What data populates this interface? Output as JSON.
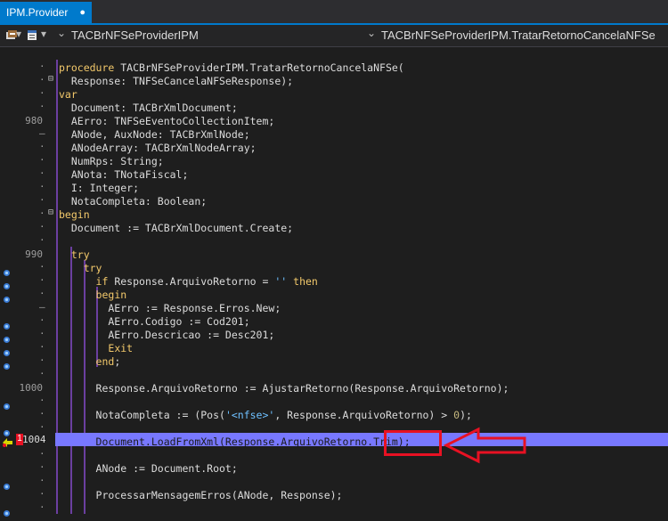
{
  "tab": {
    "title": "IPM.Provider",
    "close": "●"
  },
  "nav": {
    "left": "TACBrNFSeProviderIPM",
    "right": "TACBrNFSeProviderIPM.TratarRetornoCancelaNFSe",
    "chevron": "⌄"
  },
  "current_line": "1004",
  "current_marker": "1",
  "code_lines": [
    {
      "ln": "",
      "text": "procedure TACBrNFSeProviderIPM.TratarRetornoCancelaNFSe("
    },
    {
      "ln": "",
      "text": "  Response: TNFSeCancelaNFSeResponse);"
    },
    {
      "ln": "",
      "text": "var"
    },
    {
      "ln": "",
      "text": "  Document: TACBrXmlDocument;"
    },
    {
      "ln": "980",
      "text": "  AErro: TNFSeEventoCollectionItem;"
    },
    {
      "ln": "",
      "text": "  ANode, AuxNode: TACBrXmlNode;"
    },
    {
      "ln": "",
      "text": "  ANodeArray: TACBrXmlNodeArray;"
    },
    {
      "ln": "",
      "text": "  NumRps: String;"
    },
    {
      "ln": "",
      "text": "  ANota: TNotaFiscal;"
    },
    {
      "ln": "",
      "text": "  I: Integer;"
    },
    {
      "ln": "",
      "text": "  NotaCompleta: Boolean;"
    },
    {
      "ln": "",
      "text": "begin"
    },
    {
      "ln": "",
      "text": "  Document := TACBrXmlDocument.Create;"
    },
    {
      "ln": "",
      "text": ""
    },
    {
      "ln": "990",
      "text": "  try"
    },
    {
      "ln": "",
      "text": "    try"
    },
    {
      "ln": "",
      "text": "      if Response.ArquivoRetorno = '' then"
    },
    {
      "ln": "",
      "text": "      begin"
    },
    {
      "ln": "",
      "text": "        AErro := Response.Erros.New;"
    },
    {
      "ln": "",
      "text": "        AErro.Codigo := Cod201;"
    },
    {
      "ln": "",
      "text": "        AErro.Descricao := Desc201;"
    },
    {
      "ln": "",
      "text": "        Exit"
    },
    {
      "ln": "",
      "text": "      end;"
    },
    {
      "ln": "",
      "text": ""
    },
    {
      "ln": "1000",
      "text": "      Response.ArquivoRetorno := AjustarRetorno(Response.ArquivoRetorno);"
    },
    {
      "ln": "",
      "text": ""
    },
    {
      "ln": "",
      "text": "      NotaCompleta := (Pos('<nfse>', Response.ArquivoRetorno) > 0);"
    },
    {
      "ln": "",
      "text": ""
    },
    {
      "ln": "",
      "text": "      Document.LoadFromXml(Response.ArquivoRetorno.Trim);"
    },
    {
      "ln": "",
      "text": ""
    },
    {
      "ln": "",
      "text": "      ANode := Document.Root;"
    },
    {
      "ln": "",
      "text": ""
    },
    {
      "ln": "",
      "text": "      ProcessarMensagemErros(ANode, Response);"
    },
    {
      "ln": "",
      "text": ""
    }
  ]
}
